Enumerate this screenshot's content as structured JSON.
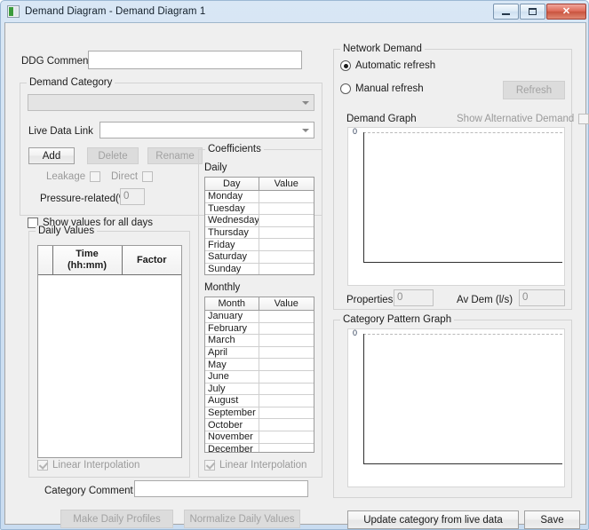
{
  "window": {
    "title": "Demand Diagram - Demand Diagram 1",
    "icon": "app-icon",
    "minimize_label": "",
    "maximize_label": "",
    "close_label": "✕"
  },
  "left": {
    "ddg_comment_label": "DDG Comment",
    "ddg_comment_value": "",
    "demand_category": {
      "group_title": "Demand Category",
      "category_combo_value": "",
      "live_data_link_label": "Live Data Link",
      "live_data_link_value": "",
      "add_label": "Add",
      "delete_label": "Delete",
      "rename_label": "Rename",
      "leakage_label": "Leakage",
      "leakage_checked": false,
      "direct_label": "Direct",
      "direct_checked": false,
      "pressure_related_label": "Pressure-related(%)",
      "pressure_related_value": "0"
    },
    "show_values_all_days_label": "Show values for all days",
    "show_values_all_days_checked": false,
    "daily_values": {
      "group_title": "Daily Values",
      "columns": [
        "",
        "Time\n(hh:mm)",
        "Factor"
      ],
      "col_time_line1": "Time",
      "col_time_line2": "(hh:mm)",
      "col_factor": "Factor",
      "rows": [],
      "linear_interpolation_label": "Linear Interpolation",
      "linear_interpolation_checked": true
    },
    "category_comment_label": "Category Comment",
    "category_comment_value": "",
    "make_daily_profiles_label": "Make Daily Profiles",
    "normalize_daily_values_label": "Normalize Daily Values"
  },
  "coefficients": {
    "group_title": "Coefficients",
    "daily_label": "Daily",
    "daily_columns": [
      "Day",
      "Value"
    ],
    "daily_rows": [
      {
        "day": "Monday",
        "value": ""
      },
      {
        "day": "Tuesday",
        "value": ""
      },
      {
        "day": "Wednesday",
        "value": ""
      },
      {
        "day": "Thursday",
        "value": ""
      },
      {
        "day": "Friday",
        "value": ""
      },
      {
        "day": "Saturday",
        "value": ""
      },
      {
        "day": "Sunday",
        "value": ""
      }
    ],
    "monthly_label": "Monthly",
    "monthly_columns": [
      "Month",
      "Value"
    ],
    "monthly_rows": [
      {
        "month": "January",
        "value": ""
      },
      {
        "month": "February",
        "value": ""
      },
      {
        "month": "March",
        "value": ""
      },
      {
        "month": "April",
        "value": ""
      },
      {
        "month": "May",
        "value": ""
      },
      {
        "month": "June",
        "value": ""
      },
      {
        "month": "July",
        "value": ""
      },
      {
        "month": "August",
        "value": ""
      },
      {
        "month": "September",
        "value": ""
      },
      {
        "month": "October",
        "value": ""
      },
      {
        "month": "November",
        "value": ""
      },
      {
        "month": "December",
        "value": ""
      }
    ],
    "linear_interpolation_label": "Linear Interpolation",
    "linear_interpolation_checked": true
  },
  "right": {
    "network_demand": {
      "group_title": "Network Demand",
      "automatic_refresh_label": "Automatic refresh",
      "manual_refresh_label": "Manual refresh",
      "selected_refresh": "automatic",
      "refresh_button_label": "Refresh",
      "demand_graph_label": "Demand Graph",
      "show_alternative_demand_label": "Show Alternative Demand",
      "show_alternative_demand_checked": false,
      "properties_label": "Properties",
      "properties_value": "0",
      "av_dem_label": "Av Dem (l/s)",
      "av_dem_value": "0"
    },
    "category_pattern_graph": {
      "group_title": "Category Pattern Graph"
    },
    "update_category_label": "Update category from live data",
    "save_label": "Save"
  },
  "chart_data": [
    {
      "type": "line",
      "title": "Demand Graph",
      "x": [],
      "values": [],
      "xlabel": "",
      "ylabel": "",
      "ytick_labels": [
        "0"
      ],
      "grid": true,
      "legend": "none",
      "note": "empty plot - axes only"
    },
    {
      "type": "line",
      "title": "Category Pattern Graph",
      "x": [],
      "values": [],
      "xlabel": "",
      "ylabel": "",
      "ytick_labels": [
        "0"
      ],
      "grid": true,
      "legend": "none",
      "note": "empty plot - axes only"
    }
  ]
}
